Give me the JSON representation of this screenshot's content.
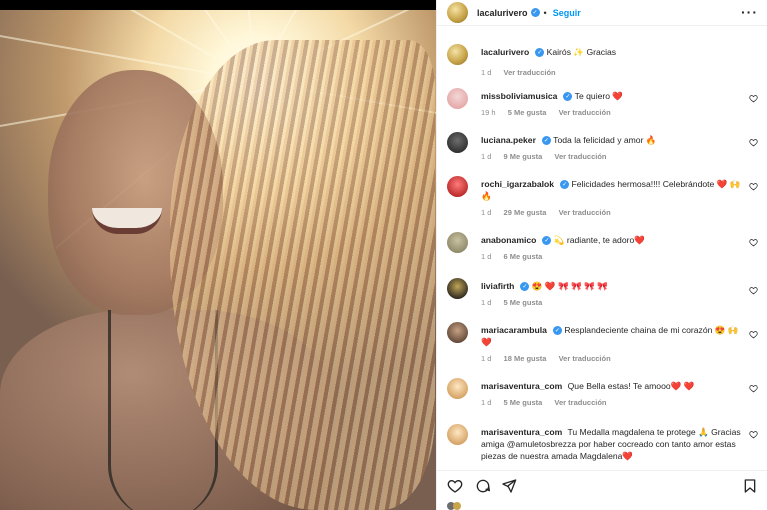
{
  "post": {
    "username": "lacalurivero",
    "follow_label": "Seguir",
    "caption": "Kairós ✨ Gracias",
    "caption_time": "1 d",
    "translate_label": "Ver traducción"
  },
  "comments": [
    {
      "user": "missboliviamusica",
      "verified": true,
      "text": "Te quiero ❤️",
      "time": "19 h",
      "likes": "5 Me gusta",
      "translate": "Ver traducción"
    },
    {
      "user": "luciana.peker",
      "verified": true,
      "text": "Toda la felicidad y amor 🔥",
      "time": "1 d",
      "likes": "9 Me gusta",
      "translate": "Ver traducción"
    },
    {
      "user": "rochi_igarzabalok",
      "verified": true,
      "text": "Felicidades hermosa!!!! Celebrándote ❤️ 🙌🔥",
      "time": "1 d",
      "likes": "29 Me gusta",
      "translate": "Ver traducción"
    },
    {
      "user": "anabonamico",
      "verified": true,
      "text": "💫 radiante, te adoro❤️",
      "time": "1 d",
      "likes": "6 Me gusta",
      "translate": ""
    },
    {
      "user": "liviafirth",
      "verified": true,
      "text": "😍 ❤️ 🎀 🎀 🎀 🎀",
      "time": "1 d",
      "likes": "5 Me gusta",
      "translate": ""
    },
    {
      "user": "mariacarambula",
      "verified": true,
      "text": "Resplandeciente chaina de mi corazón 😍 🙌❤️",
      "time": "1 d",
      "likes": "18 Me gusta",
      "translate": "Ver traducción"
    },
    {
      "user": "marisaventura_com",
      "verified": false,
      "text": "Que Bella estas! Te amooo❤️ ❤️",
      "time": "1 d",
      "likes": "5 Me gusta",
      "translate": "Ver traducción"
    },
    {
      "user": "marisaventura_com",
      "verified": false,
      "text": "Tu Medalla magdalena te protege 🙏 Gracias amiga @amuletosbrezza por haber cocreado con tanto amor estas piezas de nuestra amada Magdalena❤️",
      "time": "",
      "likes": "",
      "translate": ""
    }
  ],
  "icons": [
    "more-options-icon",
    "heart-icon",
    "comment-icon",
    "share-icon",
    "save-icon",
    "verified-icon"
  ],
  "colors": {
    "accent": "#0095f6",
    "verified": "#3897f0",
    "muted": "#8e8e8e",
    "heart_red": "#ed4956"
  }
}
